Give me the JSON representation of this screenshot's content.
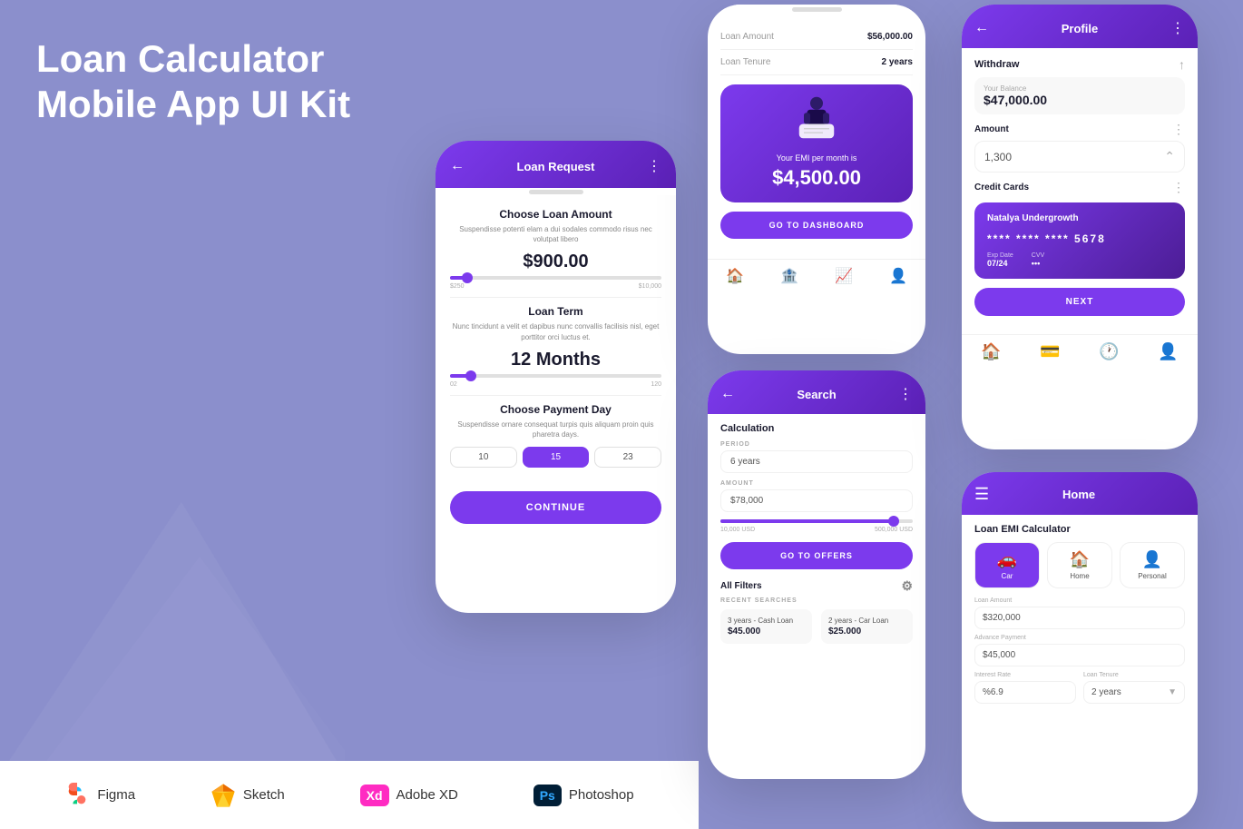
{
  "page": {
    "title_line1": "Loan Calculator",
    "title_line2": "Mobile App UI Kit",
    "bg_color": "#8B8FCC"
  },
  "tools": [
    {
      "name": "figma",
      "icon": "figma-icon",
      "label": "Figma"
    },
    {
      "name": "sketch",
      "icon": "sketch-icon",
      "label": "Sketch"
    },
    {
      "name": "xd",
      "icon": "xd-icon",
      "label": "Adobe XD"
    },
    {
      "name": "photoshop",
      "icon": "ps-icon",
      "label": "Photoshop"
    }
  ],
  "phone1": {
    "header_title": "Loan Request",
    "section1_title": "Choose Loan Amount",
    "section1_desc": "Suspendisse potenti elam a dui sodales commodo risus nec volutpat libero",
    "amount": "$900.00",
    "slider_min": "$250",
    "slider_max": "$10,000",
    "slider_pct": 8,
    "section2_title": "Loan Term",
    "section2_desc": "Nunc tincidunt a velit et dapibus nunc convallis facilisis nisl, eget porttitor orci luctus et.",
    "term": "12 Months",
    "term_min": "02",
    "term_max": "120",
    "term_pct": 10,
    "section3_title": "Choose Payment Day",
    "section3_desc": "Suspendisse ornare consequat turpis quis aliquam proin quis pharetra days.",
    "days": [
      "10",
      "15",
      "23"
    ],
    "active_day": "15",
    "continue_btn": "CONTINUE"
  },
  "phone2": {
    "loan_amount_label": "Loan Amount",
    "loan_amount_value": "$56,000.00",
    "loan_tenure_label": "Loan Tenure",
    "loan_tenure_value": "2 years",
    "emi_text": "Your EMI per month is",
    "emi_amount": "$4,500.00",
    "dashboard_btn": "GO TO DASHBOARD",
    "nav_icons": [
      "home",
      "building",
      "chart",
      "person"
    ]
  },
  "phone3": {
    "header_title": "Search",
    "calc_title": "Calculation",
    "period_label": "PERIOD",
    "period_value": "6 years",
    "amount_label": "AMOUNT",
    "amount_value": "$78,000",
    "slider_min": "10,000 USD",
    "slider_max": "500,000 USD",
    "slider_pct": 90,
    "go_offers_btn": "GO TO OFFERS",
    "all_filters": "All Filters",
    "recent_label": "RECENT SEARCHES",
    "recent_items": [
      {
        "name": "3 years - Cash Loan",
        "value": "$45.000"
      },
      {
        "name": "2 years - Car Loan",
        "value": "$25.000"
      }
    ]
  },
  "phone4": {
    "header_title": "Profile",
    "withdraw_label": "Withdraw",
    "balance_label": "Your Balance",
    "balance_value": "$47,000.00",
    "amount_label": "Amount",
    "amount_value": "1,300",
    "credit_cards_label": "Credit Cards",
    "card_name": "Natalya Undergrowth",
    "card_number": "****  ****  ****  5678",
    "exp_date_label": "Exp Date",
    "exp_date_value": "07/24",
    "cvv_label": "CVV",
    "cvv_value": "•••",
    "next_btn": "NEXT",
    "nav_icons": [
      "home",
      "card",
      "clock",
      "person"
    ]
  },
  "phone5": {
    "header_title": "Home",
    "emi_calc_label": "Loan EMI Calculator",
    "loan_types": [
      {
        "label": "Car",
        "active": true,
        "icon": "🚗"
      },
      {
        "label": "Home",
        "active": false,
        "icon": "🏠"
      },
      {
        "label": "Personal",
        "active": false,
        "icon": "👤"
      }
    ],
    "loan_amount_label": "Loan Amount",
    "loan_amount_value": "$320,000",
    "advance_label": "Advance Payment",
    "advance_value": "$45,000",
    "interest_label": "Interest Rate",
    "interest_value": "%6.9",
    "tenure_label": "Loan Tenure",
    "tenure_value": "2 years"
  }
}
